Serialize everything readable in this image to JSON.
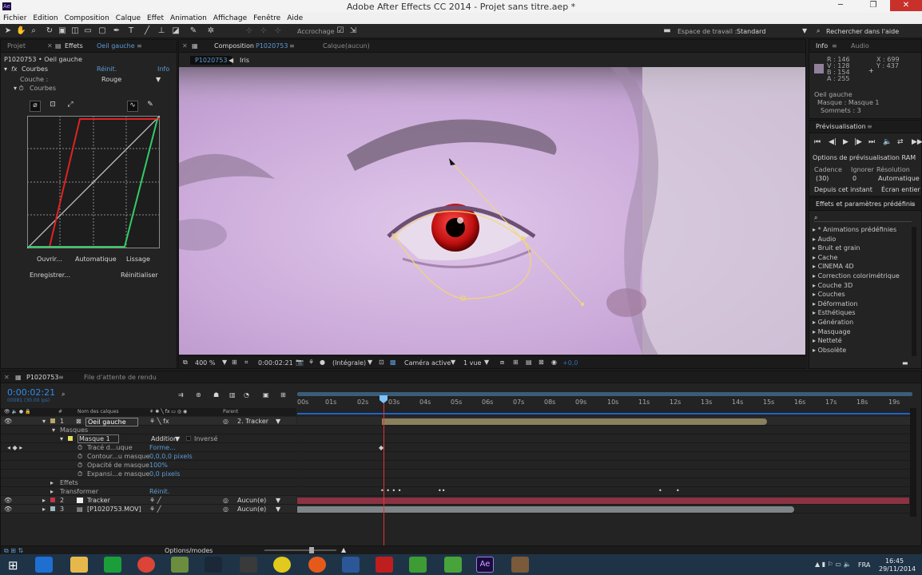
{
  "window": {
    "title": "Adobe After Effects CC 2014 - Projet sans titre.aep *",
    "app_badge": "Ae"
  },
  "menu": [
    "Fichier",
    "Edition",
    "Composition",
    "Calque",
    "Effet",
    "Animation",
    "Affichage",
    "Fenêtre",
    "Aide"
  ],
  "toolbar": {
    "accrochage": "Accrochage",
    "workspace_label": "Espace de travail :",
    "workspace_value": "Standard",
    "search_help": "Rechercher dans l'aide"
  },
  "project_panel": {
    "tab_project": "Projet",
    "tab_effects": "Effets",
    "tab_effects_target": "Oeil gauche",
    "breadcrumb": "P1020753 • Oeil gauche",
    "effect_name": "Courbes",
    "reinit": "Réinit.",
    "info": "Info",
    "channel_label": "Couche :",
    "channel_value": "Rouge",
    "sub_label": "Courbes",
    "buttons": {
      "open": "Ouvrir...",
      "auto": "Automatique",
      "smooth": "Lissage",
      "save": "Enregistrer...",
      "reset": "Réinitialiser"
    }
  },
  "composition_panel": {
    "tab": "Composition",
    "tab_name": "P1020753",
    "layer_tab": "Calque",
    "layer_tab_value": "(aucun)",
    "crumb_comp": "P1020753",
    "crumb_layer": "Iris",
    "zoom": "400 %",
    "timecode": "0:00:02:21",
    "resolution": "(Intégrale)",
    "camera": "Caméra active",
    "views": "1 vue",
    "exposure": "+0,0"
  },
  "info_panel": {
    "tab_info": "Info",
    "tab_audio": "Audio",
    "r": "R : 146",
    "v": "V : 128",
    "b": "B : 154",
    "a": "A : 255",
    "x": "X : 699",
    "y": "Y : 437",
    "line1": "Oeil gauche",
    "line2": "Masque : Masque 1",
    "line3": "Sommets : 3",
    "swatch_color": "#92809a"
  },
  "preview_panel": {
    "title": "Prévisualisation",
    "ram_options": "Options de prévisualisation RAM",
    "cadence_label": "Cadence",
    "ignore_label": "Ignorer",
    "resolution_label": "Résolution",
    "cadence_value": "(30)",
    "ignore_value": "0",
    "resolution_value": "Automatique",
    "from_now": "Depuis cet instant",
    "fullscreen": "Écran entier"
  },
  "effects_presets": {
    "title": "Effets et paramètres prédéfinis",
    "items": [
      "* Animations prédéfinies",
      "Audio",
      "Bruit et grain",
      "Cache",
      "CINEMA 4D",
      "Correction colorimétrique",
      "Couche 3D",
      "Couches",
      "Déformation",
      "Esthétiques",
      "Génération",
      "Masquage",
      "Netteté",
      "Obsolète"
    ]
  },
  "timeline": {
    "tab": "P1020753",
    "render_queue": "File d'attente de rendu",
    "timecode": "0:00:02:21",
    "frames": "00081 (30.00 ips)",
    "col_name": "Nom des calques",
    "col_parent": "Parent",
    "ticks": [
      "00s",
      "01s",
      "02s",
      "03s",
      "04s",
      "05s",
      "06s",
      "07s",
      "08s",
      "09s",
      "10s",
      "11s",
      "12s",
      "13s",
      "14s",
      "15s",
      "16s",
      "17s",
      "18s",
      "19s"
    ],
    "layers": [
      {
        "num": "1",
        "name": "Oeil gauche",
        "parent": "2. Tracker",
        "color": "#b5a66a"
      },
      {
        "num": "2",
        "name": "Tracker",
        "parent": "Aucun(e)",
        "color": "#c2364b"
      },
      {
        "num": "3",
        "name": "[P1020753.MOV]",
        "parent": "Aucun(e)",
        "color": "#9fb8bf"
      }
    ],
    "masks_label": "Masques",
    "mask_name": "Masque 1",
    "mask_mode": "Addition",
    "inverted": "Inversé",
    "props": [
      {
        "name": "Tracé d...uque",
        "value": "Forme..."
      },
      {
        "name": "Contour...u masque",
        "value": "0,0,0,0 pixels"
      },
      {
        "name": "Opacité de masque",
        "value": "100%"
      },
      {
        "name": "Expansi...e masque",
        "value": "0,0 pixels"
      }
    ],
    "effects_label": "Effets",
    "transform_label": "Transformer",
    "transform_reset": "Réinit.",
    "footer_toggle": "Options/modes"
  },
  "taskbar": {
    "lang": "FRA",
    "time": "16:45",
    "date": "29/11/2014"
  },
  "colors": {
    "accent_blue": "#2d8ceb",
    "red_curve": "#e02323",
    "green_curve": "#33cc66",
    "mask_yellow": "#f1d774",
    "playhead": "#e83232"
  }
}
